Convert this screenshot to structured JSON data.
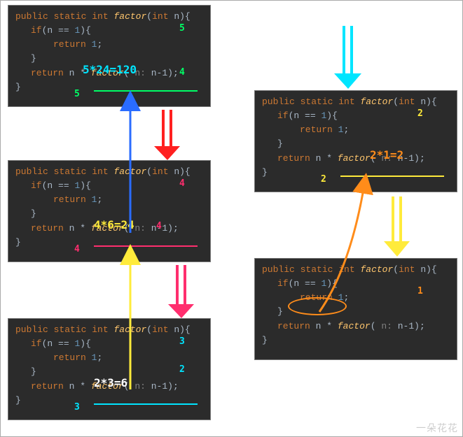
{
  "watermark": "一朵花花",
  "code": {
    "decl_kw1": "public",
    "decl_kw2": "static",
    "decl_type": "int",
    "decl_name": "factor",
    "decl_paramtype": "int",
    "decl_param": "n",
    "if_kw": "if",
    "if_cond_lhs": "n",
    "if_cond_op": "==",
    "if_cond_rhs": "1",
    "ret_kw": "return",
    "ret1_val": "1",
    "ret2_lhs": "n",
    "ret2_op": "*",
    "ret2_call": "factor",
    "ret2_hint": "n:",
    "ret2_arg": "n-1"
  },
  "blocks": {
    "b5": {
      "calc": "5*24=120",
      "anno_top": "5",
      "anno_mid": "4",
      "anno_bottom": "5",
      "calc_color": "#00e5ff",
      "anno_top_color": "#00ff66",
      "anno_mid_color": "#00ff66",
      "anno_bottom_color": "#00ff66",
      "underline_color": "#00ff66"
    },
    "b4": {
      "calc": "4*6=24",
      "anno_top": "4",
      "anno_mid": "4",
      "anno_bottom": "4",
      "calc_color": "#ffeb3b",
      "anno_top_color": "#ff2e6e",
      "anno_mid_color": "#ff2e6e",
      "anno_bottom_color": "#ff2e6e",
      "underline_color": "#ff2e6e"
    },
    "b3": {
      "calc": "2*3=6",
      "anno_top": "3",
      "anno_mid": "2",
      "anno_bottom": "3",
      "calc_color": "#ffffff",
      "anno_top_color": "#00e5ff",
      "anno_mid_color": "#00e5ff",
      "anno_bottom_color": "#00e5ff",
      "underline_color": "#00e5ff"
    },
    "b2": {
      "calc": "2*1=2",
      "anno_top": "2",
      "anno_bottom": "2",
      "calc_color": "#ff8c1a",
      "anno_top_color": "#ffeb3b",
      "anno_bottom_color": "#ffeb3b",
      "underline_color": "#ffeb3b"
    },
    "b1": {
      "anno_top": "1",
      "anno_top_color": "#ff8c1a"
    }
  }
}
